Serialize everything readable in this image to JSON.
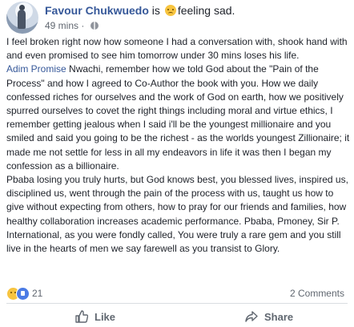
{
  "post": {
    "author": "Favour Chukwuedo",
    "feeling_prefix": "is",
    "feeling_text": "feeling sad.",
    "timestamp": "49 mins ·",
    "paragraphs": [
      "I feel broken right now how someone I had a conversation with, shook hand with and even promised to see him tomorrow under 30 mins loses his life.",
      "Pbaba losing you truly hurts, but God knows best, you blessed lives, inspired us, disciplined us, went through the pain of the process with us, taught us how to give without expecting from others, how to pray for our friends and families, how healthy collaboration increases academic performance. Pbaba, Pmoney, Sir P. International, as you were fondly called, You were truly a rare gem and you still live in the hearts of men we say farewell as you transist to Glory."
    ],
    "mention": "Adim Promise",
    "mention_rest": " Nwachi, remember how we told God about the \"Pain of the Process\" and how I agreed to Co-Author the book with you. How we daily confessed riches for ourselves and the work of God on earth, how we positively spurred ourselves to covet the right things including moral and virtue ethics, I remember getting jealous when I said i'll be the youngest millionaire and you smiled and said you going to be the richest - as the worlds youngest Zillionaire; it made me not settle for less in all my endeavors in life it was then I began my confession as a billionaire."
  },
  "footer": {
    "reaction_count": "21",
    "comments_count": "2 Comments",
    "like_label": "Like",
    "share_label": "Share"
  },
  "icons": {
    "audience": "globe-icon",
    "feeling": "sad-face-icon",
    "like": "thumbs-up-icon",
    "share": "share-arrow-icon"
  }
}
